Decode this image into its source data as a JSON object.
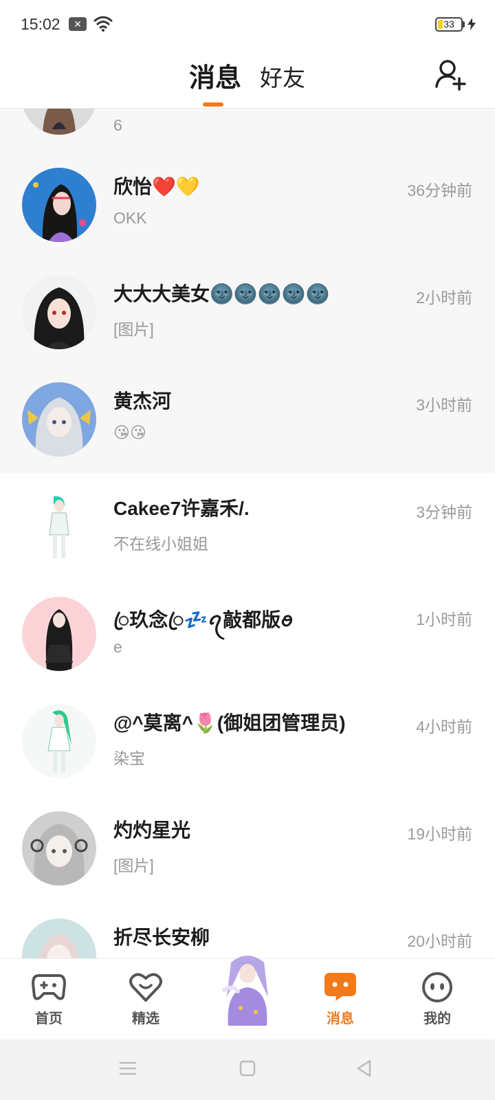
{
  "status_bar": {
    "time": "15:02",
    "notification_icon": "close-square-icon",
    "battery_level": "33"
  },
  "header": {
    "tabs": [
      {
        "label": "消息",
        "active": true
      },
      {
        "label": "好友",
        "active": false
      }
    ],
    "accent_color": "#f27a1a"
  },
  "conversations": [
    {
      "name": "",
      "preview": "6",
      "time": ""
    },
    {
      "name": "欣怡❤️💛",
      "preview": "OKK",
      "time": "36分钟前"
    },
    {
      "name": "大大大美女🌚🌚🌚🌚🌚",
      "preview": "[图片]",
      "time": "2小时前"
    },
    {
      "name": "黄杰河",
      "preview": "😘😘",
      "time": "3小时前"
    },
    {
      "name": "Cakee7许嘉禾/.",
      "preview": "不在线小姐姐",
      "time": "3分钟前"
    },
    {
      "name": "ꦿ玖念ꦿ💤ꪖ敲都版ꪮ",
      "preview": "e",
      "time": "1小时前"
    },
    {
      "name": "@^莫离^🌷(御姐团管理员)",
      "preview": "染宝",
      "time": "4小时前"
    },
    {
      "name": "灼灼星光",
      "preview": "[图片]",
      "time": "19小时前"
    },
    {
      "name": "折尽长安柳",
      "preview": "",
      "time": "20小时前"
    }
  ],
  "bottom_nav": {
    "items": [
      {
        "label": "首页",
        "icon": "gamepad-icon",
        "active": false
      },
      {
        "label": "精选",
        "icon": "heart-chat-icon",
        "active": false
      },
      {
        "label": "消息",
        "icon": "chat-bubble-icon",
        "active": true
      },
      {
        "label": "我的",
        "icon": "smiley-face-icon",
        "active": false
      }
    ]
  }
}
